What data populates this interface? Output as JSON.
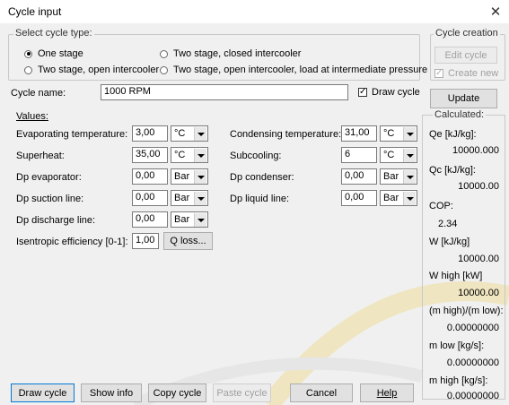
{
  "window": {
    "title": "Cycle input",
    "close_glyph": "✕"
  },
  "cycle_type": {
    "legend": "Select cycle type:",
    "options": [
      {
        "label": "One stage",
        "selected": true
      },
      {
        "label": "Two stage, closed intercooler",
        "selected": false
      },
      {
        "label": "Two stage, open intercooler",
        "selected": false
      },
      {
        "label": "Two stage, open intercooler, load at intermediate pressure",
        "selected": false
      }
    ]
  },
  "cycle_creation": {
    "legend": "Cycle creation",
    "edit_cycle": "Edit cycle",
    "create_new": "Create new"
  },
  "cycle_name": {
    "label": "Cycle name:",
    "value": "1000 RPM"
  },
  "draw_cycle_checkbox": {
    "label": "Draw cycle",
    "checked": true
  },
  "update_button": "Update",
  "values_label": "Values:",
  "fields": {
    "evap_temp": {
      "label": "Evaporating temperature:",
      "value": "3,00",
      "unit": "°C"
    },
    "superheat": {
      "label": "Superheat:",
      "value": "35,00",
      "unit": "°C"
    },
    "dp_evap": {
      "label": "Dp evaporator:",
      "value": "0,00",
      "unit": "Bar"
    },
    "dp_suction": {
      "label": "Dp suction line:",
      "value": "0,00",
      "unit": "Bar"
    },
    "dp_discharge": {
      "label": "Dp discharge line:",
      "value": "0,00",
      "unit": "Bar"
    },
    "cond_temp": {
      "label": "Condensing temperature:",
      "value": "31,00",
      "unit": "°C"
    },
    "subcooling": {
      "label": "Subcooling:",
      "value": "6",
      "unit": "°C"
    },
    "dp_cond": {
      "label": "Dp condenser:",
      "value": "0,00",
      "unit": "Bar"
    },
    "dp_liquid": {
      "label": "Dp liquid line:",
      "value": "0,00",
      "unit": "Bar"
    },
    "isentropic": {
      "label": "Isentropic efficiency [0-1]:",
      "value": "1,00"
    }
  },
  "q_loss_button": "Q loss...",
  "calculated": {
    "legend": "Calculated:",
    "items": [
      {
        "label": "Qe [kJ/kg]:",
        "value": "10000.000"
      },
      {
        "label": "Qc [kJ/kg]:",
        "value": "10000.00"
      },
      {
        "label": "COP:",
        "value": "2.34"
      },
      {
        "label": "W  [kJ/kg]",
        "value": "10000.00"
      },
      {
        "label": "W high [kW]",
        "value": "10000.00"
      },
      {
        "label": "(m high)/(m low):",
        "value": "0.00000000"
      },
      {
        "label": "m low [kg/s]:",
        "value": "0.00000000"
      },
      {
        "label": "m high [kg/s]:",
        "value": "0.00000000"
      }
    ]
  },
  "bottom_buttons": {
    "draw_cycle": "Draw cycle",
    "show_info": "Show info",
    "copy_cycle": "Copy cycle",
    "paste_cycle": "Paste cycle",
    "cancel": "Cancel",
    "help": "Help"
  },
  "colors": {
    "focus_blue": "#0078d7",
    "background_watermark": "#f5ecc4"
  }
}
